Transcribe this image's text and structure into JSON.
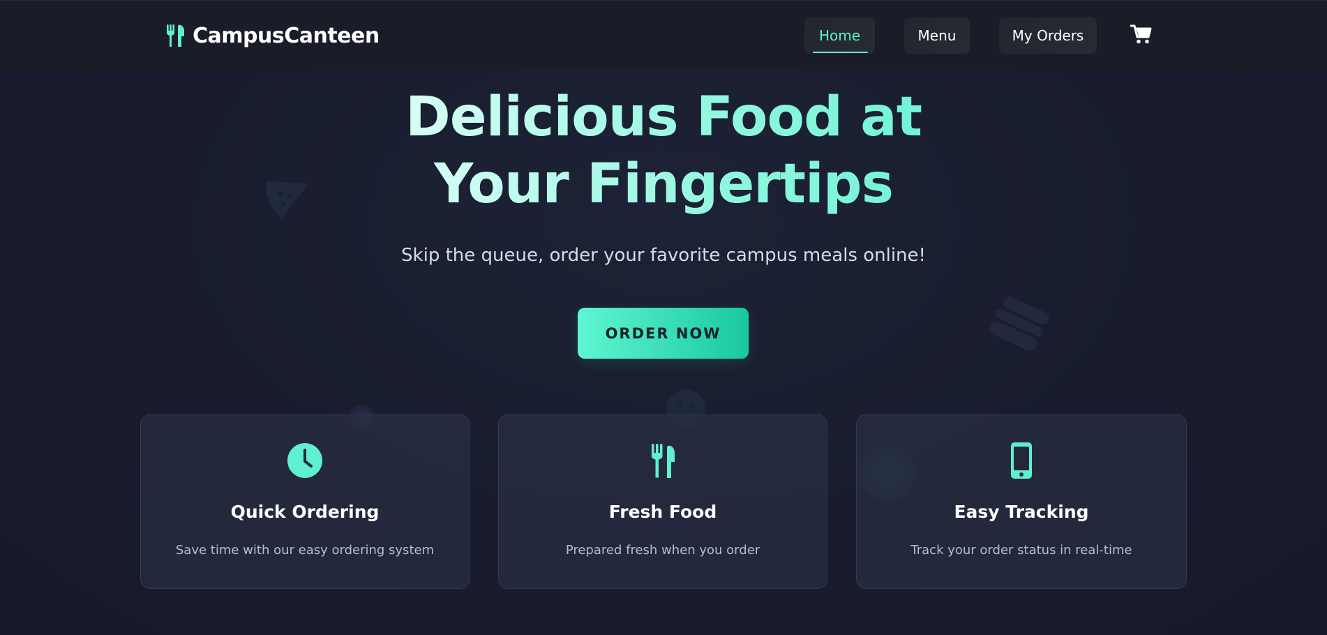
{
  "brand": {
    "name": "CampusCanteen",
    "icon": "utensils-icon"
  },
  "nav": {
    "items": [
      {
        "label": "Home",
        "active": true
      },
      {
        "label": "Menu",
        "active": false
      },
      {
        "label": "My Orders",
        "active": false
      }
    ],
    "cart_icon": "shopping-cart-icon"
  },
  "hero": {
    "title": "Delicious Food at Your Fingertips",
    "subtitle": "Skip the queue, order your favorite campus meals online!",
    "cta_label": "ORDER NOW"
  },
  "features": [
    {
      "icon": "clock-icon",
      "title": "Quick Ordering",
      "description": "Save time with our easy ordering system"
    },
    {
      "icon": "utensils-icon",
      "title": "Fresh Food",
      "description": "Prepared fresh when you order"
    },
    {
      "icon": "mobile-phone-icon",
      "title": "Easy Tracking",
      "description": "Track your order status in real-time"
    }
  ],
  "colors": {
    "accent": "#5ff0cf",
    "accent_dark": "#19c89f",
    "background": "#181c2e",
    "navbar": "#1a1c27",
    "card_bg": "#2a2e44",
    "text_muted": "#b9bccb"
  }
}
